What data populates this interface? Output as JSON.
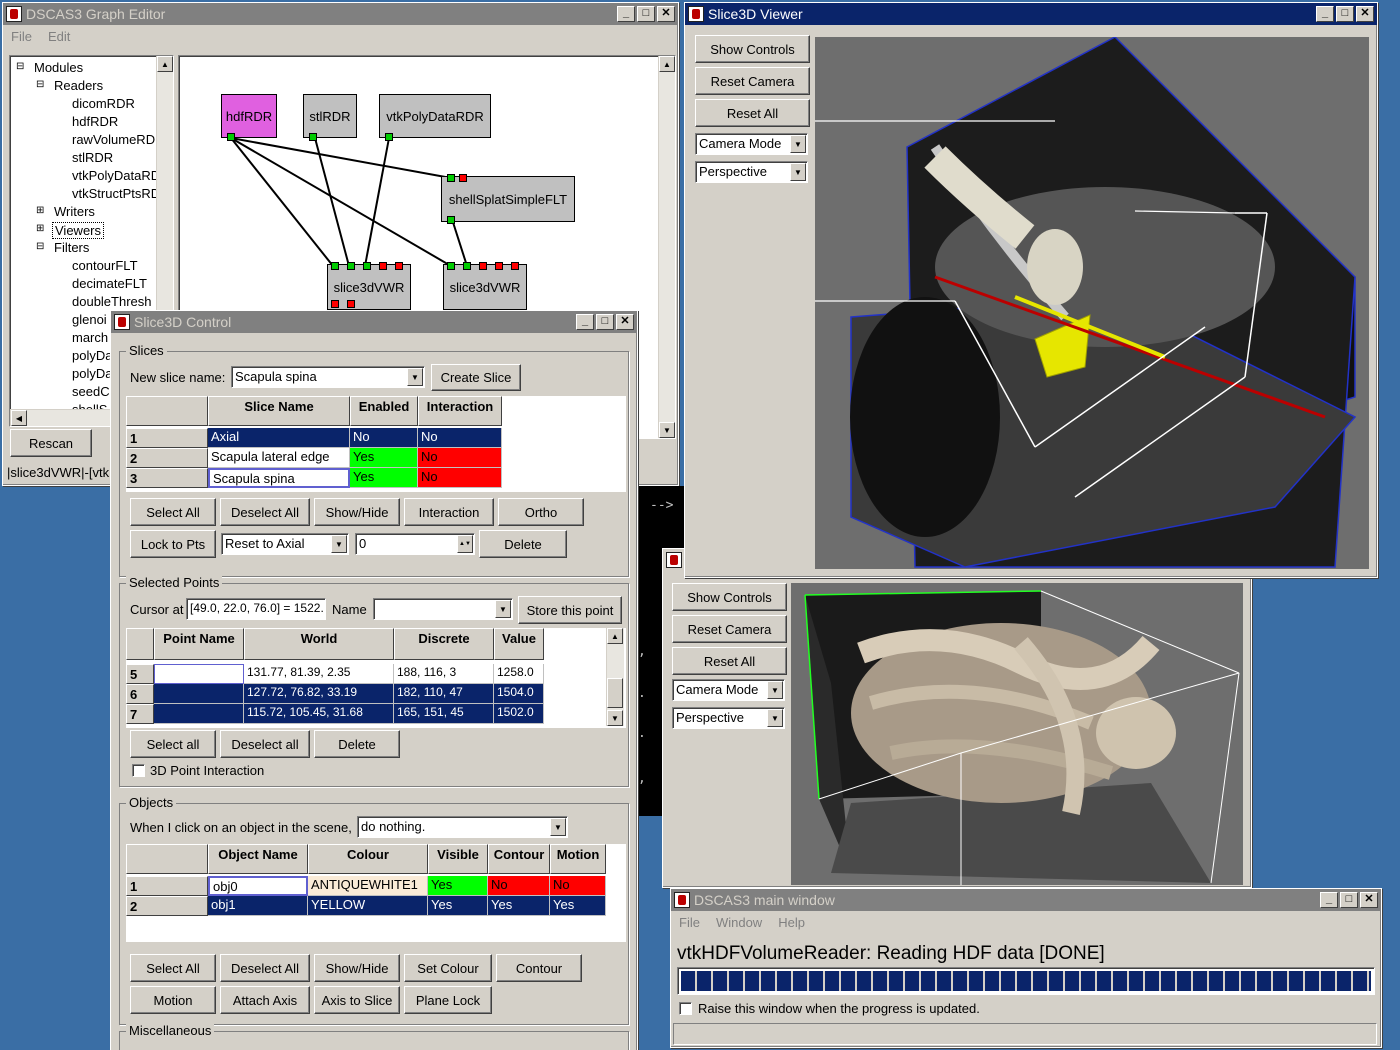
{
  "graph_editor": {
    "title": "DSCAS3 Graph Editor",
    "menu": [
      "File",
      "Edit"
    ],
    "tree": {
      "root": "Modules",
      "readers": "Readers",
      "reader_items": [
        "dicomRDR",
        "hdfRDR",
        "rawVolumeRDR",
        "stlRDR",
        "vtkPolyDataRDR",
        "vtkStructPtsRDR"
      ],
      "writers": "Writers",
      "viewers": "Viewers",
      "filters": "Filters",
      "filter_items": [
        "contourFLT",
        "decimateFLT",
        "doubleThresh",
        "glenoi",
        "march",
        "polyDa",
        "polyDa",
        "seedC",
        "shellS"
      ]
    },
    "rescan": "Rescan",
    "status": "|slice3dVWR|-[vtk",
    "nodes": [
      "hdfRDR",
      "stlRDR",
      "vtkPolyDataRDR",
      "shellSplatSimpleFLT",
      "slice3dVWR",
      "slice3dVWR"
    ]
  },
  "terminal": {
    "arrow": "-->",
    "chars": [
      ",",
      ".",
      ".",
      ",",
      ".",
      ".",
      ",",
      "."
    ]
  },
  "slice3d_viewer": {
    "title": "Slice3D Viewer",
    "show_controls": "Show Controls",
    "reset_camera": "Reset Camera",
    "reset_all": "Reset All",
    "camera_mode": "Camera Mode",
    "projection": "Perspective"
  },
  "second_viewer": {
    "show_controls": "Show Controls",
    "reset_camera": "Reset Camera",
    "reset_all": "Reset All",
    "camera_mode": "Camera Mode",
    "projection": "Perspective"
  },
  "control": {
    "title": "Slice3D Control",
    "slices": {
      "legend": "Slices",
      "new_label": "New slice name:",
      "new_value": "Scapula spina",
      "create": "Create Slice",
      "columns": [
        "Slice Name",
        "Enabled",
        "Interaction"
      ],
      "rows": [
        {
          "n": "1",
          "name": "Axial",
          "enabled": "No",
          "interaction": "No"
        },
        {
          "n": "2",
          "name": "Scapula lateral edge",
          "enabled": "Yes",
          "interaction": "No"
        },
        {
          "n": "3",
          "name": "Scapula spina",
          "enabled": "Yes",
          "interaction": "No"
        }
      ],
      "buttons": [
        "Select All",
        "Deselect All",
        "Show/Hide",
        "Interaction",
        "Ortho"
      ],
      "lock": "Lock to Pts",
      "reset_combo": "Reset to Axial",
      "spin_value": "0",
      "delete": "Delete"
    },
    "points": {
      "legend": "Selected Points",
      "cursor_label": "Cursor at",
      "cursor_value": "[49.0, 22.0, 76.0] = 1522.",
      "name_label": "Name",
      "store": "Store this point",
      "columns": [
        "Point Name",
        "World",
        "Discrete",
        "Value"
      ],
      "rows": [
        {
          "n": "5",
          "name": "",
          "world": "131.77, 81.39, 2.35",
          "discrete": "188, 116, 3",
          "value": "1258.0"
        },
        {
          "n": "6",
          "name": "",
          "world": "127.72, 76.82, 33.19",
          "discrete": "182, 110, 47",
          "value": "1504.0"
        },
        {
          "n": "7",
          "name": "",
          "world": "115.72, 105.45, 31.68",
          "discrete": "165, 151, 45",
          "value": "1502.0"
        }
      ],
      "buttons": [
        "Select all",
        "Deselect all",
        "Delete"
      ],
      "interaction": "3D Point Interaction"
    },
    "objects": {
      "legend": "Objects",
      "click_label": "When I click on an object in the scene,",
      "click_value": "do nothing.",
      "columns": [
        "Object Name",
        "Colour",
        "Visible",
        "Contour",
        "Motion"
      ],
      "rows": [
        {
          "n": "1",
          "name": "obj0",
          "colour": "ANTIQUEWHITE1",
          "visible": "Yes",
          "contour": "No",
          "motion": "No"
        },
        {
          "n": "2",
          "name": "obj1",
          "colour": "YELLOW",
          "visible": "Yes",
          "contour": "Yes",
          "motion": "Yes"
        }
      ],
      "buttons1": [
        "Select All",
        "Deselect All",
        "Show/Hide",
        "Set Colour",
        "Contour"
      ],
      "buttons2": [
        "Motion",
        "Attach Axis",
        "Axis to Slice",
        "Plane Lock"
      ]
    },
    "misc": {
      "legend": "Miscellaneous"
    }
  },
  "main_window": {
    "title": "DSCAS3 main window",
    "menu": [
      "File",
      "Window",
      "Help"
    ],
    "status": "vtkHDFVolumeReader: Reading HDF data [DONE]",
    "progress": 1.0,
    "raise": "Raise this window when the progress is updated."
  }
}
